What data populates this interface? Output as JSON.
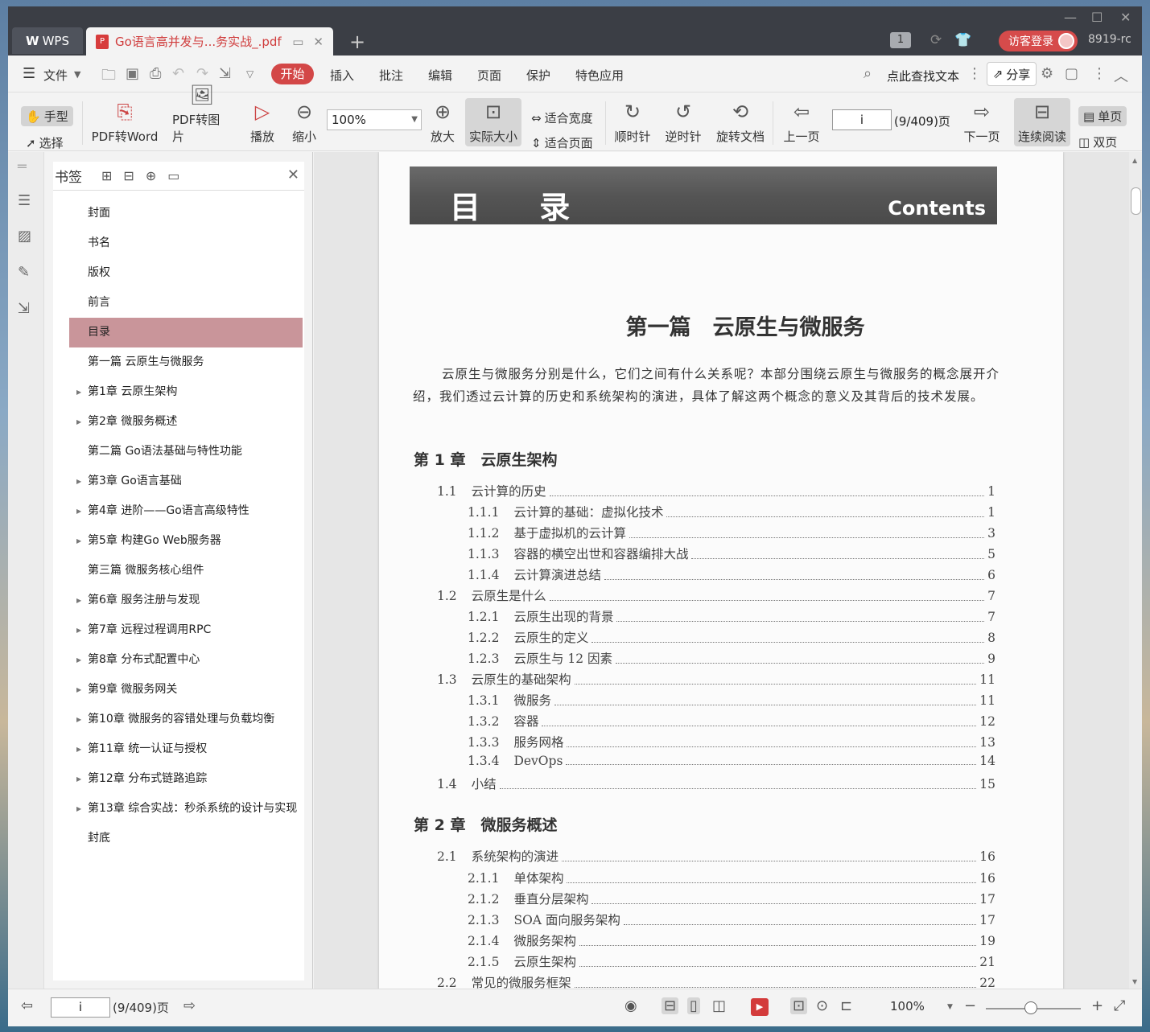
{
  "titlebar": {
    "app_label": "WPS",
    "doc_tab_title": "Go语言高并发与...务实战_.pdf",
    "login_label": "访客登录",
    "user_id": "8919-rc",
    "badge": "1"
  },
  "menubar": {
    "file": "文件",
    "tabs": [
      "开始",
      "插入",
      "批注",
      "编辑",
      "页面",
      "保护",
      "特色应用"
    ],
    "search": "点此查找文本",
    "share": "分享"
  },
  "toolbar": {
    "hand": "手型",
    "select": "选择",
    "pdf_to_word": "PDF转Word",
    "pdf_to_image": "PDF转图片",
    "play": "播放",
    "zoom_out": "缩小",
    "zoom_value": "100%",
    "zoom_in": "放大",
    "actual_size": "实际大小",
    "fit_width": "适合宽度",
    "fit_page": "适合页面",
    "rotate_cw": "顺时针",
    "rotate_ccw": "逆时针",
    "rotate_doc": "旋转文档",
    "prev_page": "上一页",
    "page_value": "i",
    "page_count": "(9/409)页",
    "next_page": "下一页",
    "continuous": "连续阅读",
    "single": "单页",
    "double": "双页"
  },
  "bookmarks": {
    "title": "书签",
    "items": [
      {
        "label": "封面",
        "expandable": false,
        "selected": false
      },
      {
        "label": "书名",
        "expandable": false,
        "selected": false
      },
      {
        "label": "版权",
        "expandable": false,
        "selected": false
      },
      {
        "label": "前言",
        "expandable": false,
        "selected": false
      },
      {
        "label": "目录",
        "expandable": false,
        "selected": true
      },
      {
        "label": "第一篇  云原生与微服务",
        "expandable": false,
        "selected": false
      },
      {
        "label": "第1章  云原生架构",
        "expandable": true,
        "selected": false
      },
      {
        "label": "第2章  微服务概述",
        "expandable": true,
        "selected": false
      },
      {
        "label": "第二篇  Go语法基础与特性功能",
        "expandable": false,
        "selected": false
      },
      {
        "label": "第3章  Go语言基础",
        "expandable": true,
        "selected": false
      },
      {
        "label": "第4章  进阶——Go语言高级特性",
        "expandable": true,
        "selected": false
      },
      {
        "label": "第5章  构建Go Web服务器",
        "expandable": true,
        "selected": false
      },
      {
        "label": "第三篇  微服务核心组件",
        "expandable": false,
        "selected": false
      },
      {
        "label": "第6章  服务注册与发现",
        "expandable": true,
        "selected": false
      },
      {
        "label": "第7章  远程过程调用RPC",
        "expandable": true,
        "selected": false
      },
      {
        "label": "第8章  分布式配置中心",
        "expandable": true,
        "selected": false
      },
      {
        "label": "第9章  微服务网关",
        "expandable": true,
        "selected": false
      },
      {
        "label": "第10章  微服务的容错处理与负载均衡",
        "expandable": true,
        "selected": false
      },
      {
        "label": "第11章  统一认证与授权",
        "expandable": true,
        "selected": false
      },
      {
        "label": "第12章  分布式链路追踪",
        "expandable": true,
        "selected": false
      },
      {
        "label": "第13章  综合实战：秒杀系统的设计与实现",
        "expandable": true,
        "selected": false
      },
      {
        "label": "封底",
        "expandable": false,
        "selected": false
      }
    ]
  },
  "page": {
    "banner_cn": "目  录",
    "banner_en": "Contents",
    "part_title": "第一篇　云原生与微服务",
    "intro": "云原生与微服务分别是什么，它们之间有什么关系呢？本部分围绕云原生与微服务的概念展开介绍，我们透过云计算的历史和系统架构的演进，具体了解这两个概念的意义及其背后的技术发展。",
    "chapter1": "第 1 章　云原生架构",
    "chapter2": "第 2 章　微服务概述",
    "toc": [
      {
        "num": "1.1",
        "title": "云计算的历史",
        "page": "1",
        "level": 1
      },
      {
        "num": "1.1.1",
        "title": "云计算的基础：虚拟化技术",
        "page": "1",
        "level": 2
      },
      {
        "num": "1.1.2",
        "title": "基于虚拟机的云计算",
        "page": "3",
        "level": 2
      },
      {
        "num": "1.1.3",
        "title": "容器的横空出世和容器编排大战",
        "page": "5",
        "level": 2
      },
      {
        "num": "1.1.4",
        "title": "云计算演进总结",
        "page": "6",
        "level": 2
      },
      {
        "num": "1.2",
        "title": "云原生是什么",
        "page": "7",
        "level": 1
      },
      {
        "num": "1.2.1",
        "title": "云原生出现的背景",
        "page": "7",
        "level": 2
      },
      {
        "num": "1.2.2",
        "title": "云原生的定义",
        "page": "8",
        "level": 2
      },
      {
        "num": "1.2.3",
        "title": "云原生与 12 因素",
        "page": "9",
        "level": 2
      },
      {
        "num": "1.3",
        "title": "云原生的基础架构",
        "page": "11",
        "level": 1
      },
      {
        "num": "1.3.1",
        "title": "微服务",
        "page": "11",
        "level": 2
      },
      {
        "num": "1.3.2",
        "title": "容器",
        "page": "12",
        "level": 2
      },
      {
        "num": "1.3.3",
        "title": "服务网格",
        "page": "13",
        "level": 2
      },
      {
        "num": "1.3.4",
        "title": "DevOps",
        "page": "14",
        "level": 2
      },
      {
        "num": "1.4",
        "title": "小结",
        "page": "15",
        "level": 1
      }
    ],
    "toc2": [
      {
        "num": "2.1",
        "title": "系统架构的演进",
        "page": "16",
        "level": 1
      },
      {
        "num": "2.1.1",
        "title": "单体架构",
        "page": "16",
        "level": 2
      },
      {
        "num": "2.1.2",
        "title": "垂直分层架构",
        "page": "17",
        "level": 2
      },
      {
        "num": "2.1.3",
        "title": "SOA 面向服务架构",
        "page": "17",
        "level": 2
      },
      {
        "num": "2.1.4",
        "title": "微服务架构",
        "page": "19",
        "level": 2
      },
      {
        "num": "2.1.5",
        "title": "云原生架构",
        "page": "21",
        "level": 2
      },
      {
        "num": "2.2",
        "title": "常见的微服务框架",
        "page": "22",
        "level": 1
      }
    ]
  },
  "statusbar": {
    "page_value": "i",
    "page_count": "(9/409)页",
    "zoom": "100%"
  }
}
